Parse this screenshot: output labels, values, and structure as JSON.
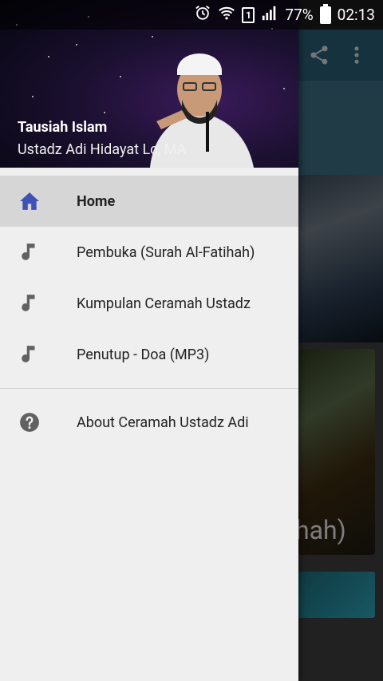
{
  "status_bar": {
    "battery_percent": "77%",
    "time": "02:13"
  },
  "drawer": {
    "header": {
      "title": "Tausiah Islam",
      "subtitle": "Ustadz Adi Hidayat Lc, MA"
    },
    "menu": [
      {
        "label": "Home",
        "icon": "home-icon",
        "active": true
      },
      {
        "label": "Pembuka (Surah Al-Fatihah)",
        "icon": "music-note-icon",
        "active": false
      },
      {
        "label": "Kumpulan Ceramah Ustadz",
        "icon": "music-note-icon",
        "active": false
      },
      {
        "label": "Penutup - Doa (MP3)",
        "icon": "music-note-icon",
        "active": false
      }
    ],
    "secondary": [
      {
        "label": "About Ceramah Ustadz Adi",
        "icon": "help-icon"
      }
    ]
  },
  "background": {
    "card_caption": "hah)"
  },
  "colors": {
    "accent_home": "#3f51b5",
    "icon_gray": "#616161",
    "toolbar": "#2b5c73"
  }
}
